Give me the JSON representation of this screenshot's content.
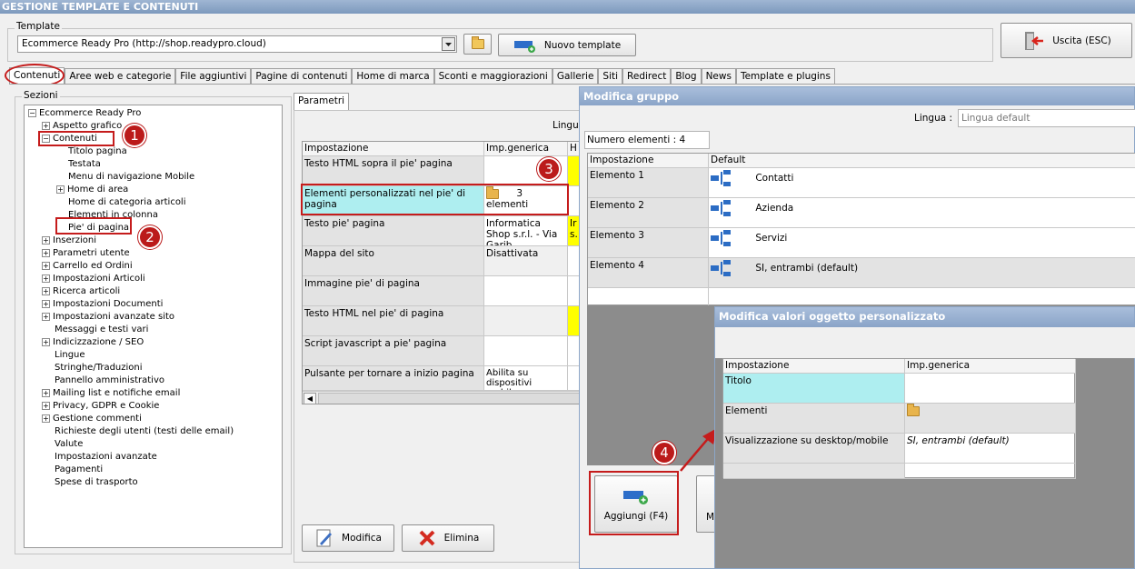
{
  "window": {
    "title": "GESTIONE TEMPLATE E CONTENUTI"
  },
  "template": {
    "label": "Template",
    "value": "Ecommerce Ready Pro (http://shop.readypro.cloud)",
    "new_button": "Nuovo template",
    "exit_button": "Uscita (ESC)"
  },
  "tabs": [
    "Contenuti",
    "Aree web e categorie",
    "File aggiuntivi",
    "Pagine di contenuti",
    "Home di marca",
    "Sconti e maggiorazioni",
    "Gallerie",
    "Siti",
    "Redirect",
    "Blog",
    "News",
    "Template e plugins"
  ],
  "sections": {
    "label": "Sezioni",
    "tree": [
      {
        "label": "Ecommerce Ready Pro",
        "expander": "−"
      },
      {
        "label": "Aspetto grafico",
        "expander": "+"
      },
      {
        "label": "Contenuti",
        "expander": "−"
      },
      {
        "label": "Titolo pagina",
        "expander": ""
      },
      {
        "label": "Testata",
        "expander": ""
      },
      {
        "label": "Menu di navigazione Mobile",
        "expander": ""
      },
      {
        "label": "Home di area",
        "expander": "+"
      },
      {
        "label": "Home di categoria articoli",
        "expander": ""
      },
      {
        "label": "Elementi in colonna",
        "expander": ""
      },
      {
        "label": "Pie' di pagina",
        "expander": ""
      },
      {
        "label": "Inserzioni",
        "expander": "+"
      },
      {
        "label": "Parametri utente",
        "expander": "+"
      },
      {
        "label": "Carrello ed Ordini",
        "expander": "+"
      },
      {
        "label": "Impostazioni Articoli",
        "expander": "+"
      },
      {
        "label": "Ricerca articoli",
        "expander": "+"
      },
      {
        "label": "Impostazioni Documenti",
        "expander": "+"
      },
      {
        "label": "Impostazioni avanzate sito",
        "expander": "+"
      },
      {
        "label": "Messaggi e testi vari",
        "expander": ""
      },
      {
        "label": "Indicizzazione / SEO",
        "expander": "+"
      },
      {
        "label": "Lingue",
        "expander": ""
      },
      {
        "label": "Stringhe/Traduzioni",
        "expander": ""
      },
      {
        "label": "Pannello amministrativo",
        "expander": ""
      },
      {
        "label": "Mailing list e notifiche email",
        "expander": "+"
      },
      {
        "label": "Privacy, GDPR e Cookie",
        "expander": "+"
      },
      {
        "label": "Gestione commenti",
        "expander": "+"
      },
      {
        "label": "Richieste degli utenti (testi delle email)",
        "expander": ""
      },
      {
        "label": "Valute",
        "expander": ""
      },
      {
        "label": "Impostazioni avanzate",
        "expander": ""
      },
      {
        "label": "Pagamenti",
        "expander": ""
      },
      {
        "label": "Spese di trasporto",
        "expander": ""
      }
    ]
  },
  "params": {
    "tab": "Parametri",
    "lingua_label": "Lingua",
    "col_impostazione": "Impostazione",
    "col_impgenerica": "Imp.generica",
    "col_h": "H",
    "rows": [
      {
        "name": "Testo HTML sopra il pie' pagina",
        "value": ""
      },
      {
        "name": "Elementi personalizzati nel pie' di pagina",
        "value": "3 elementi"
      },
      {
        "name": "Testo pie' pagina",
        "value": "Informatica Shop s.r.l. - Via Garib…",
        "h": "Ir s."
      },
      {
        "name": "Mappa del sito",
        "value": "Disattivata"
      },
      {
        "name": "Immagine pie' di pagina",
        "value": ""
      },
      {
        "name": "Testo HTML nel pie' di pagina",
        "value": ""
      },
      {
        "name": "Script javascript a pie' pagina",
        "value": ""
      },
      {
        "name": "Pulsante per tornare a inizio pagina",
        "value": "Abilita su dispositivi mobil…"
      }
    ],
    "modifica_button": "Modifica",
    "elimina_button": "Elimina"
  },
  "group_dialog": {
    "title": "Modifica gruppo",
    "lingua_label": "Lingua :",
    "lingua_placeholder": "Lingua default",
    "count_text": "Numero elementi : 4",
    "col_impostazione": "Impostazione",
    "col_default": "Default",
    "rows": [
      {
        "name": "Elemento 1",
        "value": "Contatti"
      },
      {
        "name": "Elemento 2",
        "value": "Azienda"
      },
      {
        "name": "Elemento 3",
        "value": "Servizi"
      },
      {
        "name": "Elemento 4",
        "value": "SI, entrambi (default)"
      }
    ],
    "add_button": "Aggiungi (F4)",
    "next_button_partial": "M"
  },
  "custom_dialog": {
    "title": "Modifica valori oggetto personalizzato",
    "col_impostazione": "Impostazione",
    "col_impgenerica": "Imp.generica",
    "rows": [
      {
        "name": "Titolo",
        "value": ""
      },
      {
        "name": "Elementi",
        "value": ""
      },
      {
        "name": "Visualizzazione su desktop/mobile",
        "value": "SI, entrambi (default)"
      }
    ]
  },
  "annotations": [
    "1",
    "2",
    "3",
    "4"
  ],
  "colors": {
    "highlight_red": "#c51c1c",
    "title_blue": "#8ca6c8",
    "selection_cyan": "#aeeef0",
    "yellow": "#ffff00"
  }
}
